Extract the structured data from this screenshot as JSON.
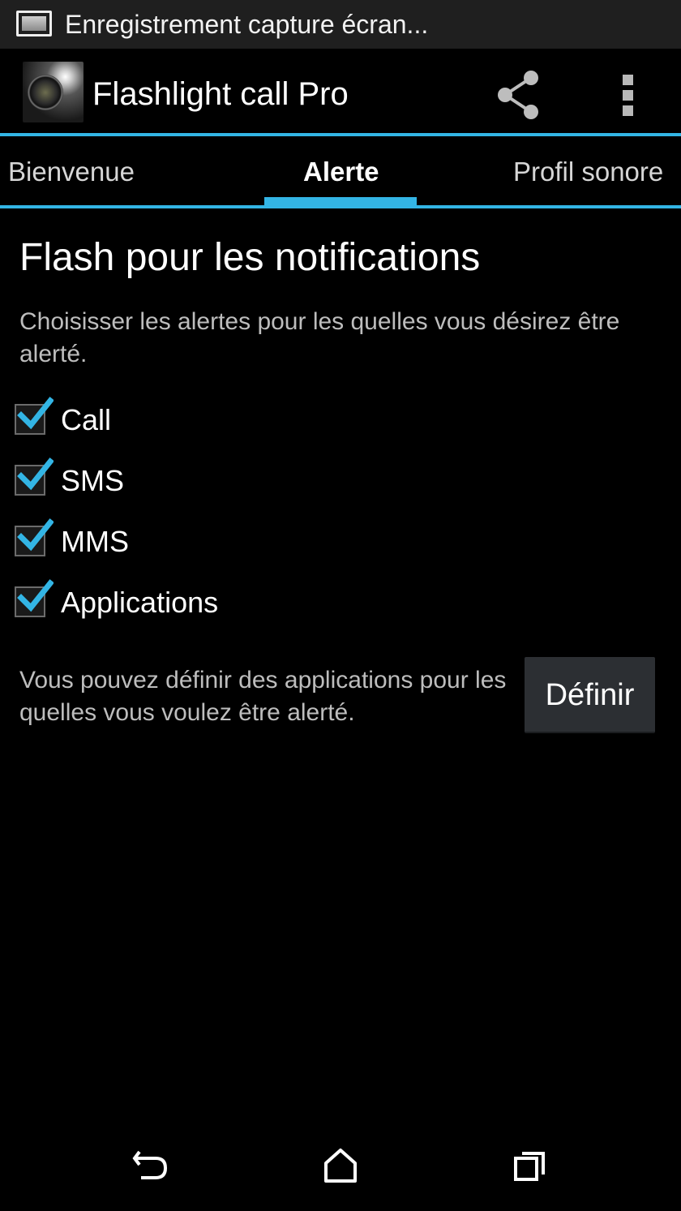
{
  "status_bar": {
    "notification_text": "Enregistrement capture écran...",
    "icon": "screenshot-notification-icon"
  },
  "action_bar": {
    "app_icon": "flashlight-app-icon",
    "title": "Flashlight call Pro",
    "share_icon": "share-icon",
    "overflow_icon": "overflow-menu-icon"
  },
  "tabs": [
    {
      "label": "Bienvenue",
      "active": false
    },
    {
      "label": "Alerte",
      "active": true
    },
    {
      "label": "Profil sonore",
      "active": false
    }
  ],
  "main": {
    "heading": "Flash pour les notifications",
    "description": "Choisisser les alertes pour les quelles vous désirez être alerté.",
    "checkboxes": [
      {
        "label": "Call",
        "checked": true
      },
      {
        "label": "SMS",
        "checked": true
      },
      {
        "label": "MMS",
        "checked": true
      },
      {
        "label": "Applications",
        "checked": true
      }
    ],
    "define_text": "Vous pouvez définir des applications pour les quelles vous voulez être alerté.",
    "define_button": "Définir"
  },
  "nav_bar": {
    "back_icon": "back-icon",
    "home_icon": "home-icon",
    "recents_icon": "recents-icon"
  },
  "colors": {
    "accent": "#33b5e5",
    "background": "#000000",
    "status_bar": "#1f1f1f",
    "button": "#2c2f33"
  }
}
